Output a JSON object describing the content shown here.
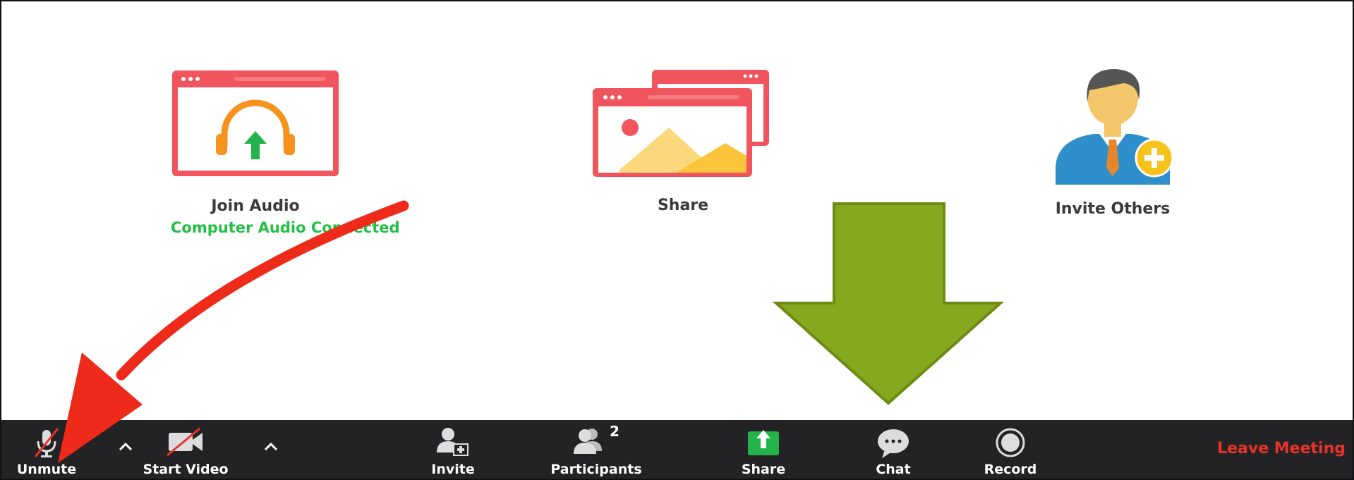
{
  "tiles": {
    "join_audio": {
      "label": "Join Audio",
      "status": "Computer Audio Connected"
    },
    "share": {
      "label": "Share"
    },
    "invite_others": {
      "label": "Invite Others"
    }
  },
  "toolbar": {
    "unmute": "Unmute",
    "start_video": "Start Video",
    "invite": "Invite",
    "participants": "Participants",
    "participants_count": "2",
    "share": "Share",
    "chat": "Chat",
    "record": "Record",
    "leave_meeting": "Leave Meeting"
  },
  "icons": {
    "join_audio": "headphones-icon",
    "share": "share-screen-icon",
    "invite_others": "invite-person-icon",
    "unmute": "muted-microphone-icon",
    "start_video": "video-off-icon",
    "invite": "add-person-icon",
    "participants": "participants-icon",
    "share_btn": "share-upload-icon",
    "chat": "chat-bubble-icon",
    "record": "record-icon"
  },
  "annotations": {
    "red_arrow": "red-arrow-pointing-unmute",
    "green_arrow": "green-arrow-pointing-down"
  },
  "colors": {
    "toolbar_bg": "#232325",
    "leave_red": "#e8332a",
    "status_green": "#21c043",
    "tile_red": "#f0545c",
    "red_arrow": "#ee2a1a",
    "green_arrow": "#86a81f"
  }
}
